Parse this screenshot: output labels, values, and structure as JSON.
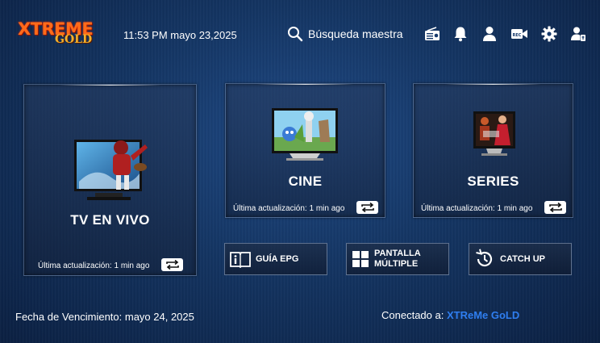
{
  "header": {
    "logo_main": "XTREME",
    "logo_sub": "GOLD",
    "clock": "11:53 PM  mayo 23,2025",
    "search_label": "Búsqueda maestra",
    "icons": [
      "search-icon",
      "radio-icon",
      "bell-icon",
      "user-icon",
      "video-record-icon",
      "gear-icon",
      "switch-user-icon"
    ]
  },
  "cards": {
    "live": {
      "title": "TV EN VIVO",
      "update": "Última actualización: 1 min ago"
    },
    "movies": {
      "title": "CINE",
      "update": "Última actualización: 1 min ago"
    },
    "series": {
      "title": "SERIES",
      "update": "Última actualización: 1 min ago"
    }
  },
  "buttons": {
    "epg": "GUÍA EPG",
    "multiscreen_line1": "PANTALLA",
    "multiscreen_line2": "MÚLTIPLE",
    "catchup": "CATCH UP"
  },
  "footer": {
    "expiry": "Fecha de Vencimiento: mayo 24, 2025",
    "connected_label": "Conectado a:",
    "connected_value": "XTReMe GoLD"
  },
  "colors": {
    "accent": "#2f7ef0",
    "logo_orange": "#ff6b1a",
    "logo_gold": "#f5b02a"
  }
}
